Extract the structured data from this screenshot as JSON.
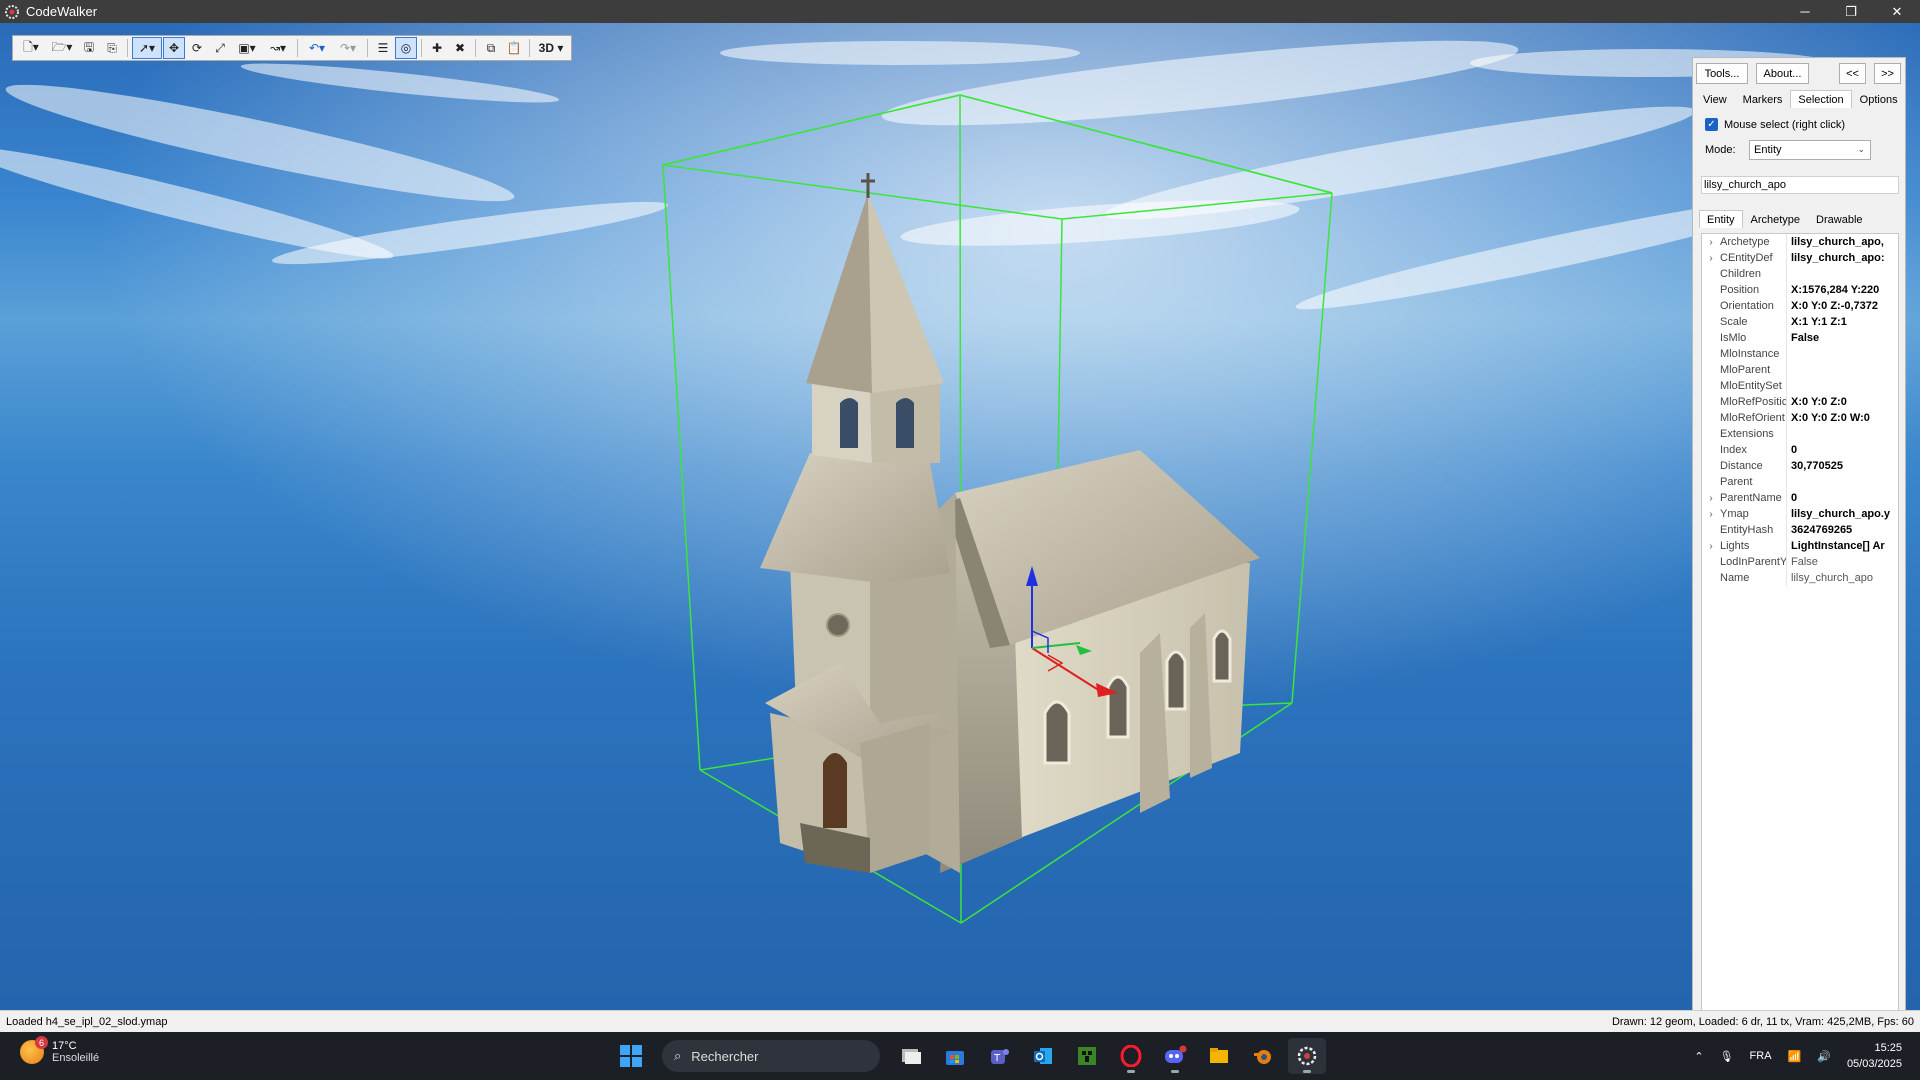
{
  "window": {
    "title": "CodeWalker",
    "controls": [
      "minimize-icon",
      "restore-icon",
      "close-icon"
    ]
  },
  "toolbar": {
    "view_mode_label": "3D"
  },
  "panel": {
    "tools_label": "Tools...",
    "about_label": "About...",
    "prev_label": "<<",
    "next_label": ">>",
    "tabs": [
      "View",
      "Markers",
      "Selection",
      "Options"
    ],
    "active_tab": "Selection",
    "mouse_select_label": "Mouse select (right click)",
    "mouse_select_checked": true,
    "mode_label": "Mode:",
    "mode_value": "Entity",
    "selected_name": "lilsy_church_apo",
    "subtabs": [
      "Entity",
      "Archetype",
      "Drawable"
    ],
    "active_subtab": "Entity",
    "properties": [
      {
        "key": "Archetype",
        "value": "lilsy_church_apo,",
        "expandable": true
      },
      {
        "key": "CEntityDef",
        "value": "lilsy_church_apo:",
        "expandable": true
      },
      {
        "key": "Children",
        "value": "",
        "expandable": false
      },
      {
        "key": "Position",
        "value": "X:1576,284 Y:220",
        "expandable": false
      },
      {
        "key": "Orientation",
        "value": "X:0 Y:0 Z:-0,7372",
        "expandable": false
      },
      {
        "key": "Scale",
        "value": "X:1 Y:1 Z:1",
        "expandable": false
      },
      {
        "key": "IsMlo",
        "value": "False",
        "expandable": false
      },
      {
        "key": "MloInstance",
        "value": "",
        "expandable": false
      },
      {
        "key": "MloParent",
        "value": "",
        "expandable": false
      },
      {
        "key": "MloEntitySet",
        "value": "",
        "expandable": false
      },
      {
        "key": "MloRefPositic",
        "value": "X:0 Y:0 Z:0",
        "expandable": false
      },
      {
        "key": "MloRefOrient",
        "value": "X:0 Y:0 Z:0 W:0",
        "expandable": false
      },
      {
        "key": "Extensions",
        "value": "",
        "expandable": false
      },
      {
        "key": "Index",
        "value": "0",
        "expandable": false
      },
      {
        "key": "Distance",
        "value": "30,770525",
        "expandable": false
      },
      {
        "key": "Parent",
        "value": "",
        "expandable": false
      },
      {
        "key": "ParentName",
        "value": "0",
        "expandable": true
      },
      {
        "key": "Ymap",
        "value": "lilsy_church_apo.y",
        "expandable": true
      },
      {
        "key": "EntityHash",
        "value": "3624769265",
        "expandable": false
      },
      {
        "key": "Lights",
        "value": "LightInstance[] Ar",
        "expandable": true
      },
      {
        "key": "LodInParentY",
        "value": "False",
        "expandable": false,
        "light": true
      },
      {
        "key": "Name",
        "value": "lilsy_church_apo",
        "expandable": false,
        "light": true
      }
    ]
  },
  "statusbar": {
    "left": "Loaded h4_se_ipl_02_slod.ymap",
    "right": "Drawn: 12 geom, Loaded: 6 dr, 11 tx, Vram: 425,2MB, Fps: 60"
  },
  "taskbar": {
    "temperature": "17°C",
    "weather": "Ensoleillé",
    "weather_badge": "6",
    "search_placeholder": "Rechercher",
    "language": "FRA",
    "time": "15:25",
    "date": "05/03/2025"
  },
  "colors": {
    "selection_box": "#39e639",
    "gizmo_x": "#e02020",
    "gizmo_y": "#20c040",
    "gizmo_z": "#2030e0",
    "accent": "#1a63c4"
  }
}
